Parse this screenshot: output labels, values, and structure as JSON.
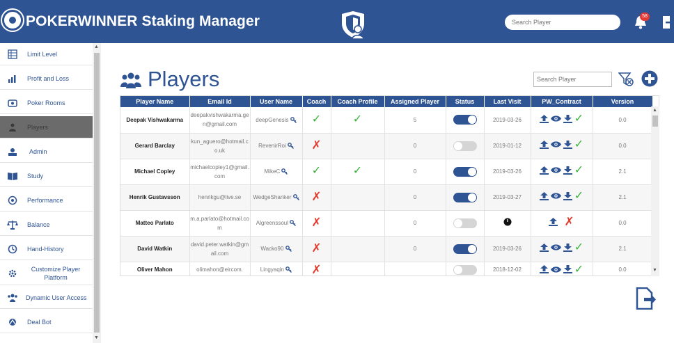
{
  "header": {
    "title": "POKERWINNER Staking Manager",
    "search_placeholder": "Search Player",
    "notification_count": "58"
  },
  "sidebar": {
    "items": [
      {
        "label": "Limit Level",
        "icon": "table-icon"
      },
      {
        "label": "Profit and Loss",
        "icon": "bar-chart-icon"
      },
      {
        "label": "Poker Rooms",
        "icon": "poker-room-icon"
      },
      {
        "label": "Players",
        "icon": "players-icon",
        "active": true
      },
      {
        "label": "Admin",
        "icon": "admin-icon"
      },
      {
        "label": "Study",
        "icon": "book-icon"
      },
      {
        "label": "Performance",
        "icon": "performance-icon"
      },
      {
        "label": "Balance",
        "icon": "balance-scale-icon"
      },
      {
        "label": "Hand-History",
        "icon": "history-icon"
      },
      {
        "label": "Customize Player Platform",
        "icon": "customize-gear-icon"
      },
      {
        "label": "Dynamic User Access",
        "icon": "user-access-icon"
      },
      {
        "label": "Deal Bot",
        "icon": "deal-bot-icon"
      }
    ]
  },
  "main": {
    "title": "Players",
    "search_placeholder": "Search Player"
  },
  "table": {
    "columns": [
      "Player Name",
      "Email Id",
      "User Name",
      "Coach",
      "Coach Profile",
      "Assigned Player",
      "Status",
      "Last Visit",
      "PW_Contract",
      "Version"
    ],
    "rows": [
      {
        "name": "Deepak Vishwakarma",
        "email": "deepakvishwakarma.gen@gmail.com",
        "username": "deepGenesis",
        "coach": true,
        "coach_profile": true,
        "assigned": "5",
        "status": true,
        "last_visit": "2019-03-26",
        "contract": "full",
        "version": "0.0"
      },
      {
        "name": "Gerard Barclay",
        "email": "kun_aguero@hotmail.co.uk",
        "username": "RevenirRoi",
        "coach": false,
        "coach_profile": false,
        "assigned": "0",
        "status": false,
        "last_visit": "2019-01-12",
        "contract": "full",
        "version": "0.0"
      },
      {
        "name": "Michael Copley",
        "email": "michaelcopley1@gmail.com",
        "username": "MikeC",
        "coach": true,
        "coach_profile": true,
        "assigned": "0",
        "status": true,
        "last_visit": "2019-03-26",
        "contract": "full",
        "version": "2.1"
      },
      {
        "name": "Henrik Gustavsson",
        "email": "henrikgu@live.se",
        "username": "WedgeShanker",
        "coach": false,
        "coach_profile": false,
        "assigned": "0",
        "status": true,
        "last_visit": "2019-03-27",
        "contract": "full",
        "version": "2.1"
      },
      {
        "name": "Matteo Parlato",
        "email": "m.a.parlato@hotmail.com",
        "username": "Algreenssoul",
        "coach": false,
        "coach_profile": false,
        "assigned": "0",
        "status": false,
        "last_visit": "",
        "contract": "upload-only",
        "version": "0.0"
      },
      {
        "name": "David Watkin",
        "email": "david.peter.watkin@gmail.com",
        "username": "Wacko90",
        "coach": false,
        "coach_profile": false,
        "assigned": "0",
        "status": true,
        "last_visit": "2019-03-26",
        "contract": "full",
        "version": "2.1"
      },
      {
        "name": "Oliver Mahon",
        "email": "olimahon@eircom.",
        "username": "Lingyaqin",
        "coach": false,
        "coach_profile": false,
        "assigned": "",
        "status": false,
        "last_visit": "2018-12-02",
        "contract": "full",
        "version": "0.0"
      }
    ]
  },
  "colors": {
    "brand": "#2f5494",
    "check": "#3bb33b",
    "cross": "#e23b2e",
    "badge": "#e53935"
  }
}
